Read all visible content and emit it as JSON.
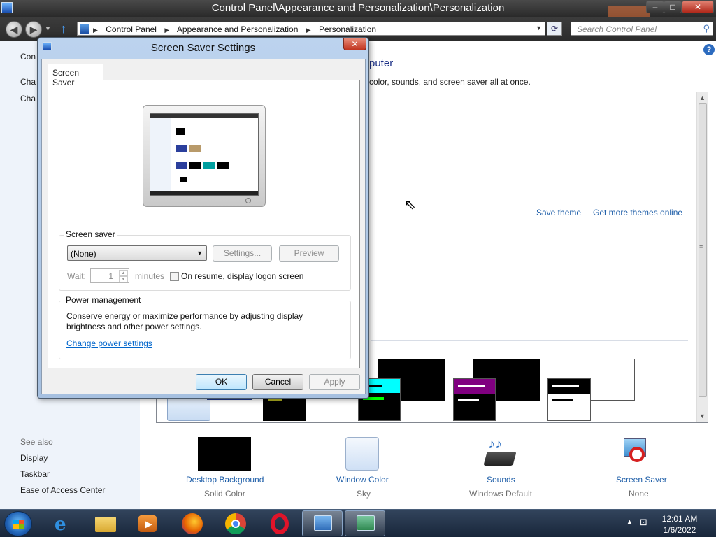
{
  "window": {
    "title": "Control Panel\\Appearance and Personalization\\Personalization",
    "min": "–",
    "max": "□",
    "close": "✕"
  },
  "nav": {
    "back": "◀",
    "forward": "▶",
    "dropdown": "▼",
    "up": "↑",
    "breadcrumbs": [
      "Control Panel",
      "Appearance and Personalization",
      "Personalization"
    ],
    "refresh": "⟳",
    "search_placeholder": "Search Control Panel",
    "search_icon": "⚲"
  },
  "left_pane": {
    "frag1": "Con",
    "frag2": "Cha",
    "frag3": "Cha",
    "see_also": "See also",
    "links": [
      "Display",
      "Taskbar",
      "Ease of Access Center"
    ]
  },
  "main": {
    "help": "?",
    "heading_fragment": "puter",
    "sub_fragment": "color, sounds, and screen saver all at once.",
    "save_theme": "Save theme",
    "get_more": "Get more themes online"
  },
  "bottom_items": [
    {
      "label": "Desktop Background",
      "value": "Solid Color"
    },
    {
      "label": "Window Color",
      "value": "Sky"
    },
    {
      "label": "Sounds",
      "value": "Windows Default"
    },
    {
      "label": "Screen Saver",
      "value": "None"
    }
  ],
  "dialog": {
    "title": "Screen Saver Settings",
    "close": "✕",
    "tab": "Screen Saver",
    "screen_saver_group": "Screen saver",
    "selected": "(None)",
    "settings_btn": "Settings...",
    "preview_btn": "Preview",
    "wait_label": "Wait:",
    "wait_value": "1",
    "minutes": "minutes",
    "on_resume": "On resume, display logon screen",
    "power_group": "Power management",
    "power_text": "Conserve energy or maximize performance by adjusting display brightness and other power settings.",
    "power_link": "Change power settings",
    "ok": "OK",
    "cancel": "Cancel",
    "apply": "Apply"
  },
  "taskbar": {
    "time": "12:01 AM",
    "date": "1/6/2022",
    "tray_arrow": "▲",
    "tray_network": "⊡"
  },
  "colors": {
    "link": "#1e5ea8",
    "accent": "#3c7fb1"
  }
}
